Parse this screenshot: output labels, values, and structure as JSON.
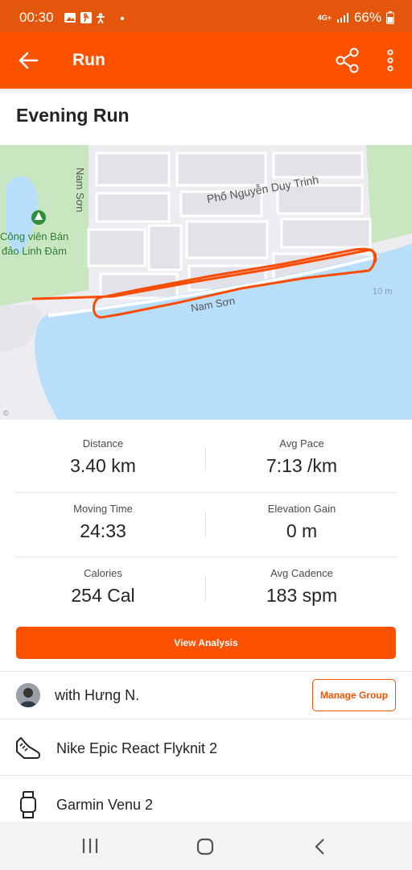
{
  "status_bar": {
    "time": "00:30",
    "network": "4G+",
    "battery": "66%"
  },
  "app_bar": {
    "title": "Run"
  },
  "activity": {
    "title": "Evening Run"
  },
  "map": {
    "street_labels": [
      "Nam Sơn",
      "Phố Nguyễn Duy Trinh",
      "Nam Sơn",
      "10 m"
    ],
    "park_label_line1": "Công viên Bán",
    "park_label_line2": "đảo Linh Đàm",
    "route_color": "#fc4c02",
    "water_color": "#b7defa",
    "park_color": "#c8e7c0"
  },
  "stats": [
    {
      "label": "Distance",
      "value": "3.40 km"
    },
    {
      "label": "Avg Pace",
      "value": "7:13 /km"
    },
    {
      "label": "Moving Time",
      "value": "24:33"
    },
    {
      "label": "Elevation Gain",
      "value": "0 m"
    },
    {
      "label": "Calories",
      "value": "254 Cal"
    },
    {
      "label": "Avg Cadence",
      "value": "183 spm"
    }
  ],
  "actions": {
    "view_analysis": "View Analysis",
    "manage_group": "Manage Group"
  },
  "group": {
    "with_text": "with Hưng N."
  },
  "gear": {
    "shoes": "Nike Epic React Flyknit 2",
    "device": "Garmin Venu 2"
  },
  "colors": {
    "brand": "#fc5200",
    "status_bar": "#e4560c"
  }
}
